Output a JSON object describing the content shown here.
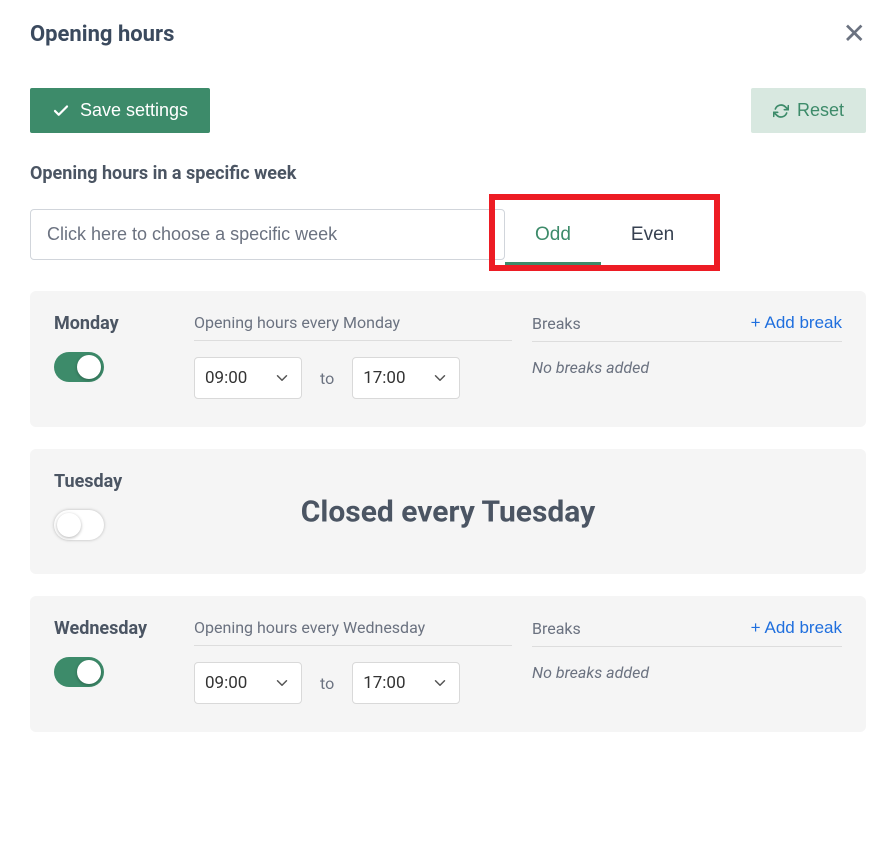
{
  "header": {
    "title": "Opening hours"
  },
  "actions": {
    "save_label": "Save settings",
    "reset_label": "Reset"
  },
  "week_picker": {
    "label": "Opening hours in a specific week",
    "placeholder": "Click here to choose a specific week"
  },
  "tabs": {
    "odd": "Odd",
    "even": "Even",
    "active": "odd"
  },
  "days": {
    "monday": {
      "name": "Monday",
      "enabled": true,
      "hours_label": "Opening hours every Monday",
      "open": "09:00",
      "to_label": "to",
      "close": "17:00",
      "breaks_label": "Breaks",
      "add_break_label": "Add break",
      "no_breaks_text": "No breaks added"
    },
    "tuesday": {
      "name": "Tuesday",
      "enabled": false,
      "closed_text": "Closed every Tuesday"
    },
    "wednesday": {
      "name": "Wednesday",
      "enabled": true,
      "hours_label": "Opening hours every Wednesday",
      "open": "09:00",
      "to_label": "to",
      "close": "17:00",
      "breaks_label": "Breaks",
      "add_break_label": "Add break",
      "no_breaks_text": "No breaks added"
    }
  }
}
